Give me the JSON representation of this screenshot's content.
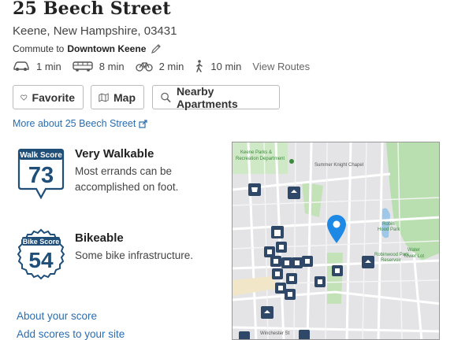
{
  "header": {
    "street": "25 Beech Street",
    "city": "Keene",
    "state_zip": ", New Hampshire, 03431"
  },
  "commute": {
    "prefix": "Commute to",
    "destination": "Downtown Keene",
    "modes": [
      {
        "icon": "car-icon",
        "time": "1 min"
      },
      {
        "icon": "bus-icon",
        "time": "8 min"
      },
      {
        "icon": "bike-icon",
        "time": "2 min"
      },
      {
        "icon": "walk-icon",
        "time": "10 min"
      }
    ],
    "view_routes": "View Routes"
  },
  "actions": {
    "favorite": "Favorite",
    "map": "Map",
    "nearby": "Nearby Apartments"
  },
  "more_link": "More about 25 Beech Street",
  "walk_score": {
    "badge_label": "Walk Score",
    "value": "73",
    "heading": "Very Walkable",
    "desc_line1": "Most errands can be",
    "desc_line2": "accomplished on foot."
  },
  "bike_score": {
    "badge_label": "Bike Score",
    "value": "54",
    "heading": "Bikeable",
    "desc": "Some bike infrastructure."
  },
  "links": {
    "about": "About your score",
    "add": "Add scores to your site"
  },
  "map_labels": {
    "parks": "Keene Parks &",
    "parks2": "Recreation Department",
    "chapel": "Summer Knight Chapel",
    "robin": "Robin",
    "hood": "Hood Park",
    "robinwood": "Robinwood Park",
    "reservoir": "Reservoir",
    "water": "Water",
    "tower": "Tower Lot",
    "street": "Winchester St"
  },
  "colors": {
    "link": "#2a6db0",
    "badge": "#1f4e79",
    "pin": "#1e88e5",
    "park": "#b9dfb0"
  }
}
